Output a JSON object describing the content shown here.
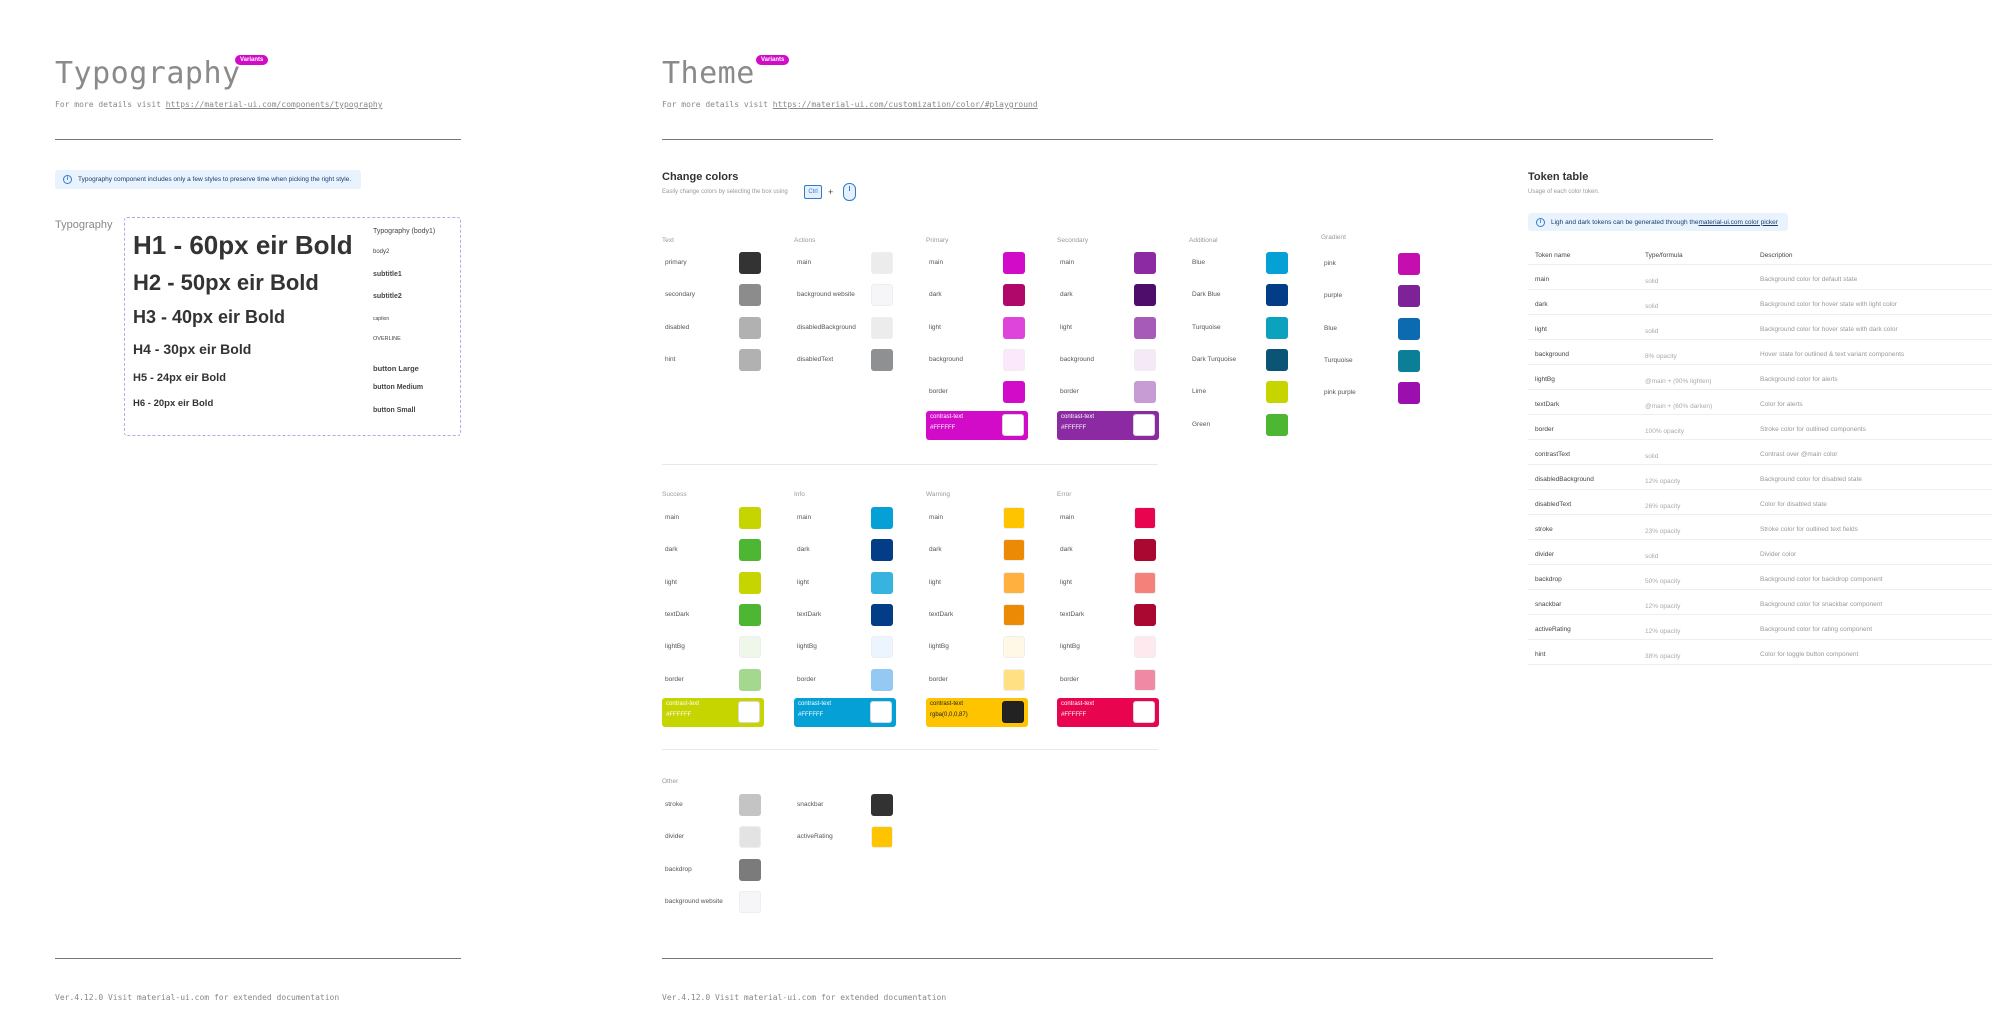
{
  "typography": {
    "title": "Typography",
    "badge": "Variants",
    "subtitle_prefix": "For more details visit ",
    "subtitle_link": "https://material-ui.com/components/typography",
    "info": "Typography component includes only a few styles to preserve time when picking the right style.",
    "side_label": "Typography",
    "headings": [
      "H1 - 60px eir Bold",
      "H2 - 50px eir Bold",
      "H3 - 40px eir Bold",
      "H4 - 30px eir Bold",
      "H5 - 24px eir Bold",
      "H6 - 20px eir Bold"
    ],
    "right_variants": [
      "Typography (body1)",
      "body2",
      "subtitle1",
      "subtitle2",
      "caption",
      "OVERLINE",
      "button Large",
      "button Medium",
      "button Small"
    ],
    "footer": "Ver.4.12.0  Visit material-ui.com for extended documentation"
  },
  "theme": {
    "title": "Theme",
    "badge": "Variants",
    "subtitle_prefix": "For more details visit ",
    "subtitle_link": "https://material-ui.com/customization/color/#playground",
    "change_colors": {
      "title": "Change colors",
      "subtitle": "Easily change colors by selecting the box using",
      "kbd": "Ctrl",
      "plus": "+"
    },
    "footer": "Ver.4.12.0  Visit material-ui.com for extended documentation",
    "groups": [
      {
        "name": "Text",
        "rows": [
          {
            "label": "primary",
            "color": "#333333"
          },
          {
            "label": "secondary",
            "color": "#8c8c8c"
          },
          {
            "label": "disabled",
            "color": "#b1b1b1"
          },
          {
            "label": "hint",
            "color": "#b1b1b1"
          }
        ]
      },
      {
        "name": "Actions",
        "rows": [
          {
            "label": "main",
            "color": "#ececec"
          },
          {
            "label": "background website",
            "color": "#f6f6f8"
          },
          {
            "label": "disabledBackground",
            "color": "#ececec"
          },
          {
            "label": "disabledText",
            "color": "#8e9091"
          }
        ]
      },
      {
        "name": "Primary",
        "rows": [
          {
            "label": "main",
            "color": "#d10bc7"
          },
          {
            "label": "dark",
            "color": "#b0076a"
          },
          {
            "label": "light",
            "color": "#de45db"
          },
          {
            "label": "background",
            "color": "#fbe8fa"
          },
          {
            "label": "border",
            "color": "#d10bc7"
          }
        ],
        "contrast": {
          "label": "contrast-text",
          "value": "#FFFFFF",
          "bg": "#d10bc7",
          "fg": "#ffffff",
          "box": "#ffffff"
        }
      },
      {
        "name": "Secondary",
        "rows": [
          {
            "label": "main",
            "color": "#8b2aa3"
          },
          {
            "label": "dark",
            "color": "#4f0d6b"
          },
          {
            "label": "light",
            "color": "#a55bb7"
          },
          {
            "label": "background",
            "color": "#f5e9f7"
          },
          {
            "label": "border",
            "color": "#c79bd4"
          }
        ],
        "contrast": {
          "label": "contrast-text",
          "value": "#FFFFFF",
          "bg": "#8b2aa3",
          "fg": "#ffffff",
          "box": "#ffffff"
        }
      },
      {
        "name": "Additional",
        "rows": [
          {
            "label": "Blue",
            "color": "#05a0d6"
          },
          {
            "label": "Dark Blue",
            "color": "#033c87"
          },
          {
            "label": "Turquoise",
            "color": "#0ba2bd"
          },
          {
            "label": "Dark Turquoise",
            "color": "#0b5475"
          },
          {
            "label": "Lime",
            "color": "#c6d500"
          },
          {
            "label": "Green",
            "color": "#4db632"
          }
        ]
      },
      {
        "name": "Gradient",
        "rows": [
          {
            "label": "pink",
            "color": "#c40fae"
          },
          {
            "label": "purple",
            "color": "#7e2297"
          },
          {
            "label": "Blue",
            "color": "#0c6bb0"
          },
          {
            "label": "Turquoise",
            "color": "#0b7e98"
          },
          {
            "label": "pink purple",
            "color": "#9a0fad"
          }
        ]
      },
      {
        "name": "Success",
        "rows": [
          {
            "label": "main",
            "color": "#c6d500"
          },
          {
            "label": "dark",
            "color": "#4db632"
          },
          {
            "label": "light",
            "color": "#c6d500"
          },
          {
            "label": "textDark",
            "color": "#4db632"
          },
          {
            "label": "lightBg",
            "color": "#eef7e9"
          },
          {
            "label": "border",
            "color": "#a4d88f"
          }
        ],
        "contrast": {
          "label": "contrast-text",
          "value": "#FFFFFF",
          "bg": "#c6d500",
          "fg": "#ffffff",
          "box": "#ffffff"
        }
      },
      {
        "name": "Info",
        "rows": [
          {
            "label": "main",
            "color": "#05a0d6"
          },
          {
            "label": "dark",
            "color": "#033c87"
          },
          {
            "label": "light",
            "color": "#37b3e0"
          },
          {
            "label": "textDark",
            "color": "#033c87"
          },
          {
            "label": "lightBg",
            "color": "#ecf5fd"
          },
          {
            "label": "border",
            "color": "#93c9f2"
          }
        ],
        "contrast": {
          "label": "contrast-text",
          "value": "#FFFFFF",
          "bg": "#05a0d6",
          "fg": "#ffffff",
          "box": "#ffffff"
        }
      },
      {
        "name": "Warning",
        "rows": [
          {
            "label": "main",
            "color": "#ffc400"
          },
          {
            "label": "dark",
            "color": "#ec8a05"
          },
          {
            "label": "light",
            "color": "#ffb03e"
          },
          {
            "label": "textDark",
            "color": "#ec8a05"
          },
          {
            "label": "lightBg",
            "color": "#fff8e7"
          },
          {
            "label": "border",
            "color": "#ffe184"
          }
        ],
        "contrast": {
          "label": "contrast-text",
          "value": "rgba(0,0,0,87)",
          "bg": "#ffc400",
          "fg": "#222222",
          "box": "#222222"
        }
      },
      {
        "name": "Error",
        "rows": [
          {
            "label": "main",
            "color": "#e8044f"
          },
          {
            "label": "dark",
            "color": "#aa0830"
          },
          {
            "label": "light",
            "color": "#f4827b"
          },
          {
            "label": "textDark",
            "color": "#aa0830"
          },
          {
            "label": "lightBg",
            "color": "#fde9ee"
          },
          {
            "label": "border",
            "color": "#f08aa4"
          }
        ],
        "contrast": {
          "label": "contrast-text",
          "value": "#FFFFFF",
          "bg": "#e8044f",
          "fg": "#ffffff",
          "box": "#ffffff"
        }
      },
      {
        "name": "Other",
        "rows": [
          {
            "label": "stroke",
            "color": "#c4c4c4"
          },
          {
            "label": "divider",
            "color": "#e3e3e3"
          },
          {
            "label": "backdrop",
            "color": "#7b7b7b"
          },
          {
            "label": "background website",
            "color": "#f6f6f8"
          }
        ]
      },
      {
        "name": "",
        "rows": [
          {
            "label": "snackbar",
            "color": "#323232"
          },
          {
            "label": "activeRating",
            "color": "#ffc400"
          }
        ]
      }
    ]
  },
  "token_table": {
    "title": "Token table",
    "subtitle": "Usage of each color token.",
    "info_prefix": "Ligh and dark tokens can be generated through the ",
    "info_link": "material-ui.com color picker",
    "headers": [
      "Token name",
      "Type/formula",
      "Description"
    ],
    "rows": [
      [
        "main",
        "solid",
        "Background color for default state"
      ],
      [
        "dark",
        "solid",
        "Background color for hover state with light color"
      ],
      [
        "light",
        "solid",
        "Background color for hover state with dark color"
      ],
      [
        "background",
        "8% opacity",
        "Hover state for outlined & text variant components"
      ],
      [
        "lightBg",
        "@main + (90% lighten)",
        "Background color for alerts"
      ],
      [
        "textDark",
        "@main + (60% darken)",
        "Color for alerts"
      ],
      [
        "border",
        "100% opacity",
        "Stroke color for outlined components"
      ],
      [
        "contrastText",
        "solid",
        "Contrast over @main color"
      ],
      [
        "disabledBackground",
        "12% opacity",
        "Background color for disabled state"
      ],
      [
        "disabledText",
        "26% opacity",
        "Color for disabled state"
      ],
      [
        "stroke",
        "23% opacity",
        "Stroke color for outlined text fields"
      ],
      [
        "divider",
        "solid",
        "Divider color"
      ],
      [
        "backdrop",
        "50% opacity",
        "Background color for backdrop component"
      ],
      [
        "snackbar",
        "12% opacity",
        "Background color for snackbar component"
      ],
      [
        "activeRating",
        "12% opacity",
        "Background color for rating component"
      ],
      [
        "hint",
        "38% opacity",
        "Color for toggle button component"
      ]
    ]
  }
}
